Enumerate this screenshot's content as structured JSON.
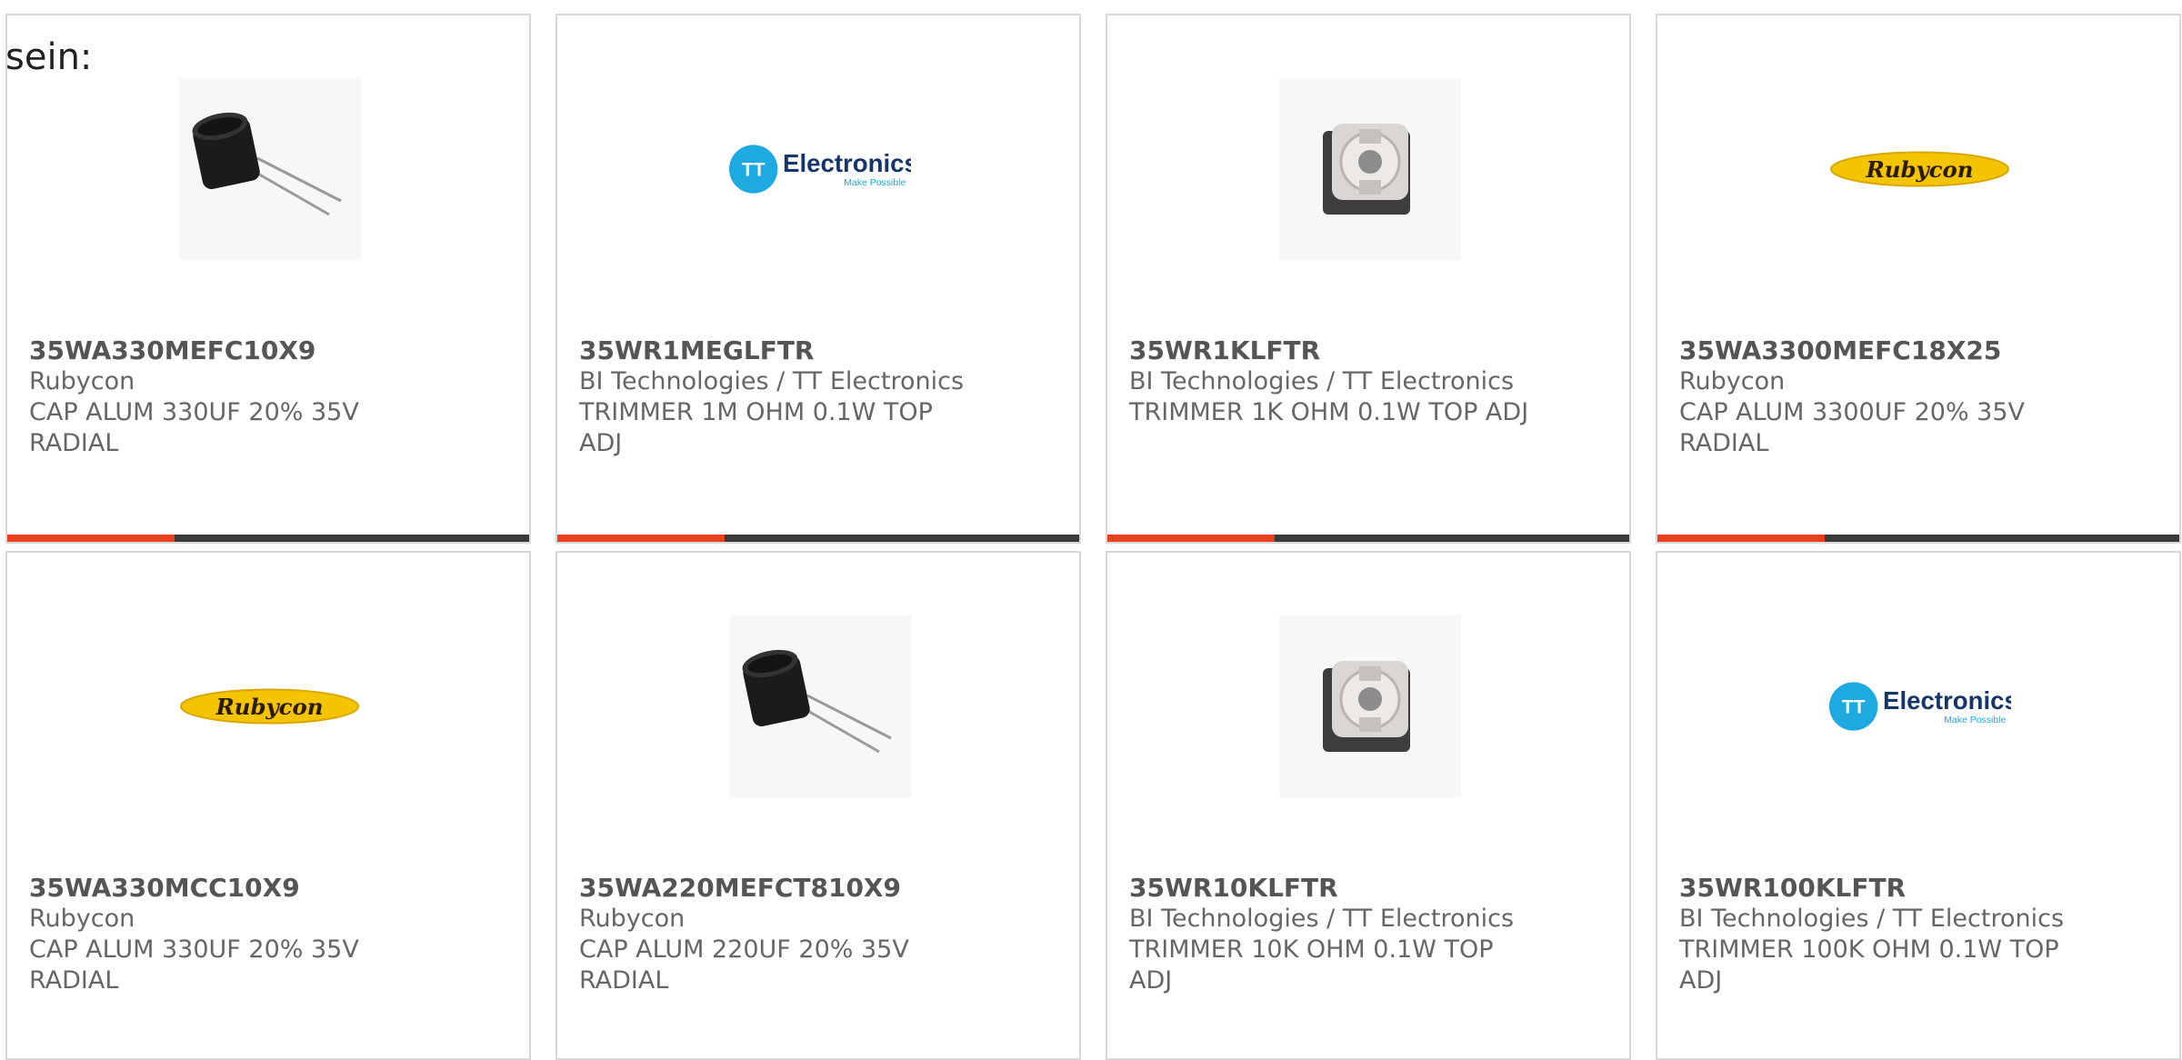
{
  "intro_text": "sein:",
  "colors": {
    "accent": "#e8401c",
    "bar": "#3a3a3a",
    "tt_blue": "#1ea9e1",
    "rubycon_yellow": "#f5c400"
  },
  "products": [
    {
      "part_number": "35WA330MEFC10X9",
      "manufacturer": "Rubycon",
      "desc_line1": "CAP ALUM 330UF 20% 35V",
      "desc_line2": "RADIAL",
      "image": "capacitor-photo"
    },
    {
      "part_number": "35WR1MEGLFTR",
      "manufacturer": "BI Technologies / TT Electronics",
      "desc_line1": "TRIMMER 1M OHM 0.1W TOP",
      "desc_line2": "ADJ",
      "image": "tt-electronics-logo"
    },
    {
      "part_number": "35WR1KLFTR",
      "manufacturer": "BI Technologies / TT Electronics",
      "desc_line1": "TRIMMER 1K OHM 0.1W TOP ADJ",
      "desc_line2": "",
      "image": "trimmer-photo"
    },
    {
      "part_number": "35WA3300MEFC18X25",
      "manufacturer": "Rubycon",
      "desc_line1": "CAP ALUM 3300UF 20% 35V",
      "desc_line2": "RADIAL",
      "image": "rubycon-logo"
    },
    {
      "part_number": "35WA330MCC10X9",
      "manufacturer": "Rubycon",
      "desc_line1": "CAP ALUM 330UF 20% 35V",
      "desc_line2": "RADIAL",
      "image": "rubycon-logo"
    },
    {
      "part_number": "35WA220MEFCT810X9",
      "manufacturer": "Rubycon",
      "desc_line1": "CAP ALUM 220UF 20% 35V",
      "desc_line2": "RADIAL",
      "image": "capacitor-photo"
    },
    {
      "part_number": "35WR10KLFTR",
      "manufacturer": "BI Technologies / TT Electronics",
      "desc_line1": "TRIMMER 10K OHM 0.1W TOP",
      "desc_line2": "ADJ",
      "image": "trimmer-photo"
    },
    {
      "part_number": "35WR100KLFTR",
      "manufacturer": "BI Technologies / TT Electronics",
      "desc_line1": "TRIMMER 100K OHM 0.1W TOP",
      "desc_line2": "ADJ",
      "image": "tt-electronics-logo"
    }
  ],
  "logos": {
    "tt_mark": "TT",
    "tt_word": "Electronics",
    "tt_tagline": "Make Possible",
    "rubycon_word": "Rubycon"
  }
}
